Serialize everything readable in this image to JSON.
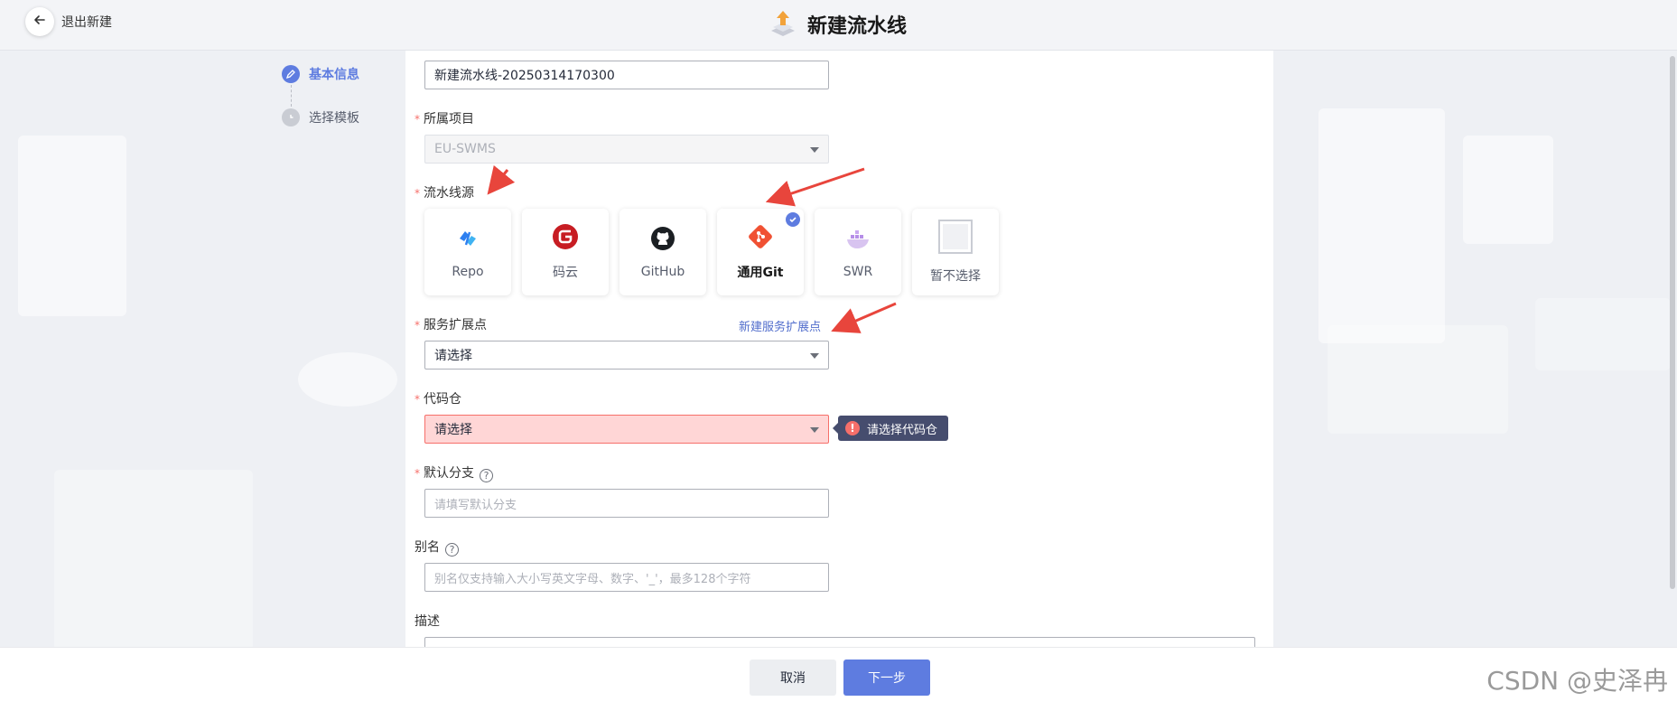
{
  "header": {
    "back_label": "退出新建",
    "title": "新建流水线"
  },
  "steps": [
    {
      "label": "基本信息",
      "state": "active"
    },
    {
      "label": "选择模板",
      "state": "idle"
    }
  ],
  "form": {
    "name_value": "新建流水线-20250314170300",
    "project": {
      "label": "所属项目",
      "value": "EU-SWMS"
    },
    "source": {
      "label": "流水线源",
      "options": [
        {
          "label": "Repo",
          "icon": "repo-icon"
        },
        {
          "label": "码云",
          "icon": "gitee-icon"
        },
        {
          "label": "GitHub",
          "icon": "github-icon"
        },
        {
          "label": "通用Git",
          "icon": "git-icon",
          "selected": true
        },
        {
          "label": "SWR",
          "icon": "swr-icon"
        },
        {
          "label": "暂不选择",
          "icon": "none-icon"
        }
      ]
    },
    "endpoint": {
      "label": "服务扩展点",
      "placeholder": "请选择",
      "link": "新建服务扩展点"
    },
    "repo": {
      "label": "代码仓",
      "placeholder": "请选择",
      "error": "请选择代码仓"
    },
    "branch": {
      "label": "默认分支",
      "placeholder": "请填写默认分支"
    },
    "alias": {
      "label": "别名",
      "placeholder": "别名仅支持输入大小写英文字母、数字、'_'，最多128个字符"
    },
    "description": {
      "label": "描述"
    }
  },
  "footer": {
    "cancel": "取消",
    "next": "下一步"
  },
  "watermark": "CSDN @史泽冉",
  "colors": {
    "accent": "#5e7ce0",
    "error": "#f66f6a",
    "annotation": "#e8453c"
  }
}
